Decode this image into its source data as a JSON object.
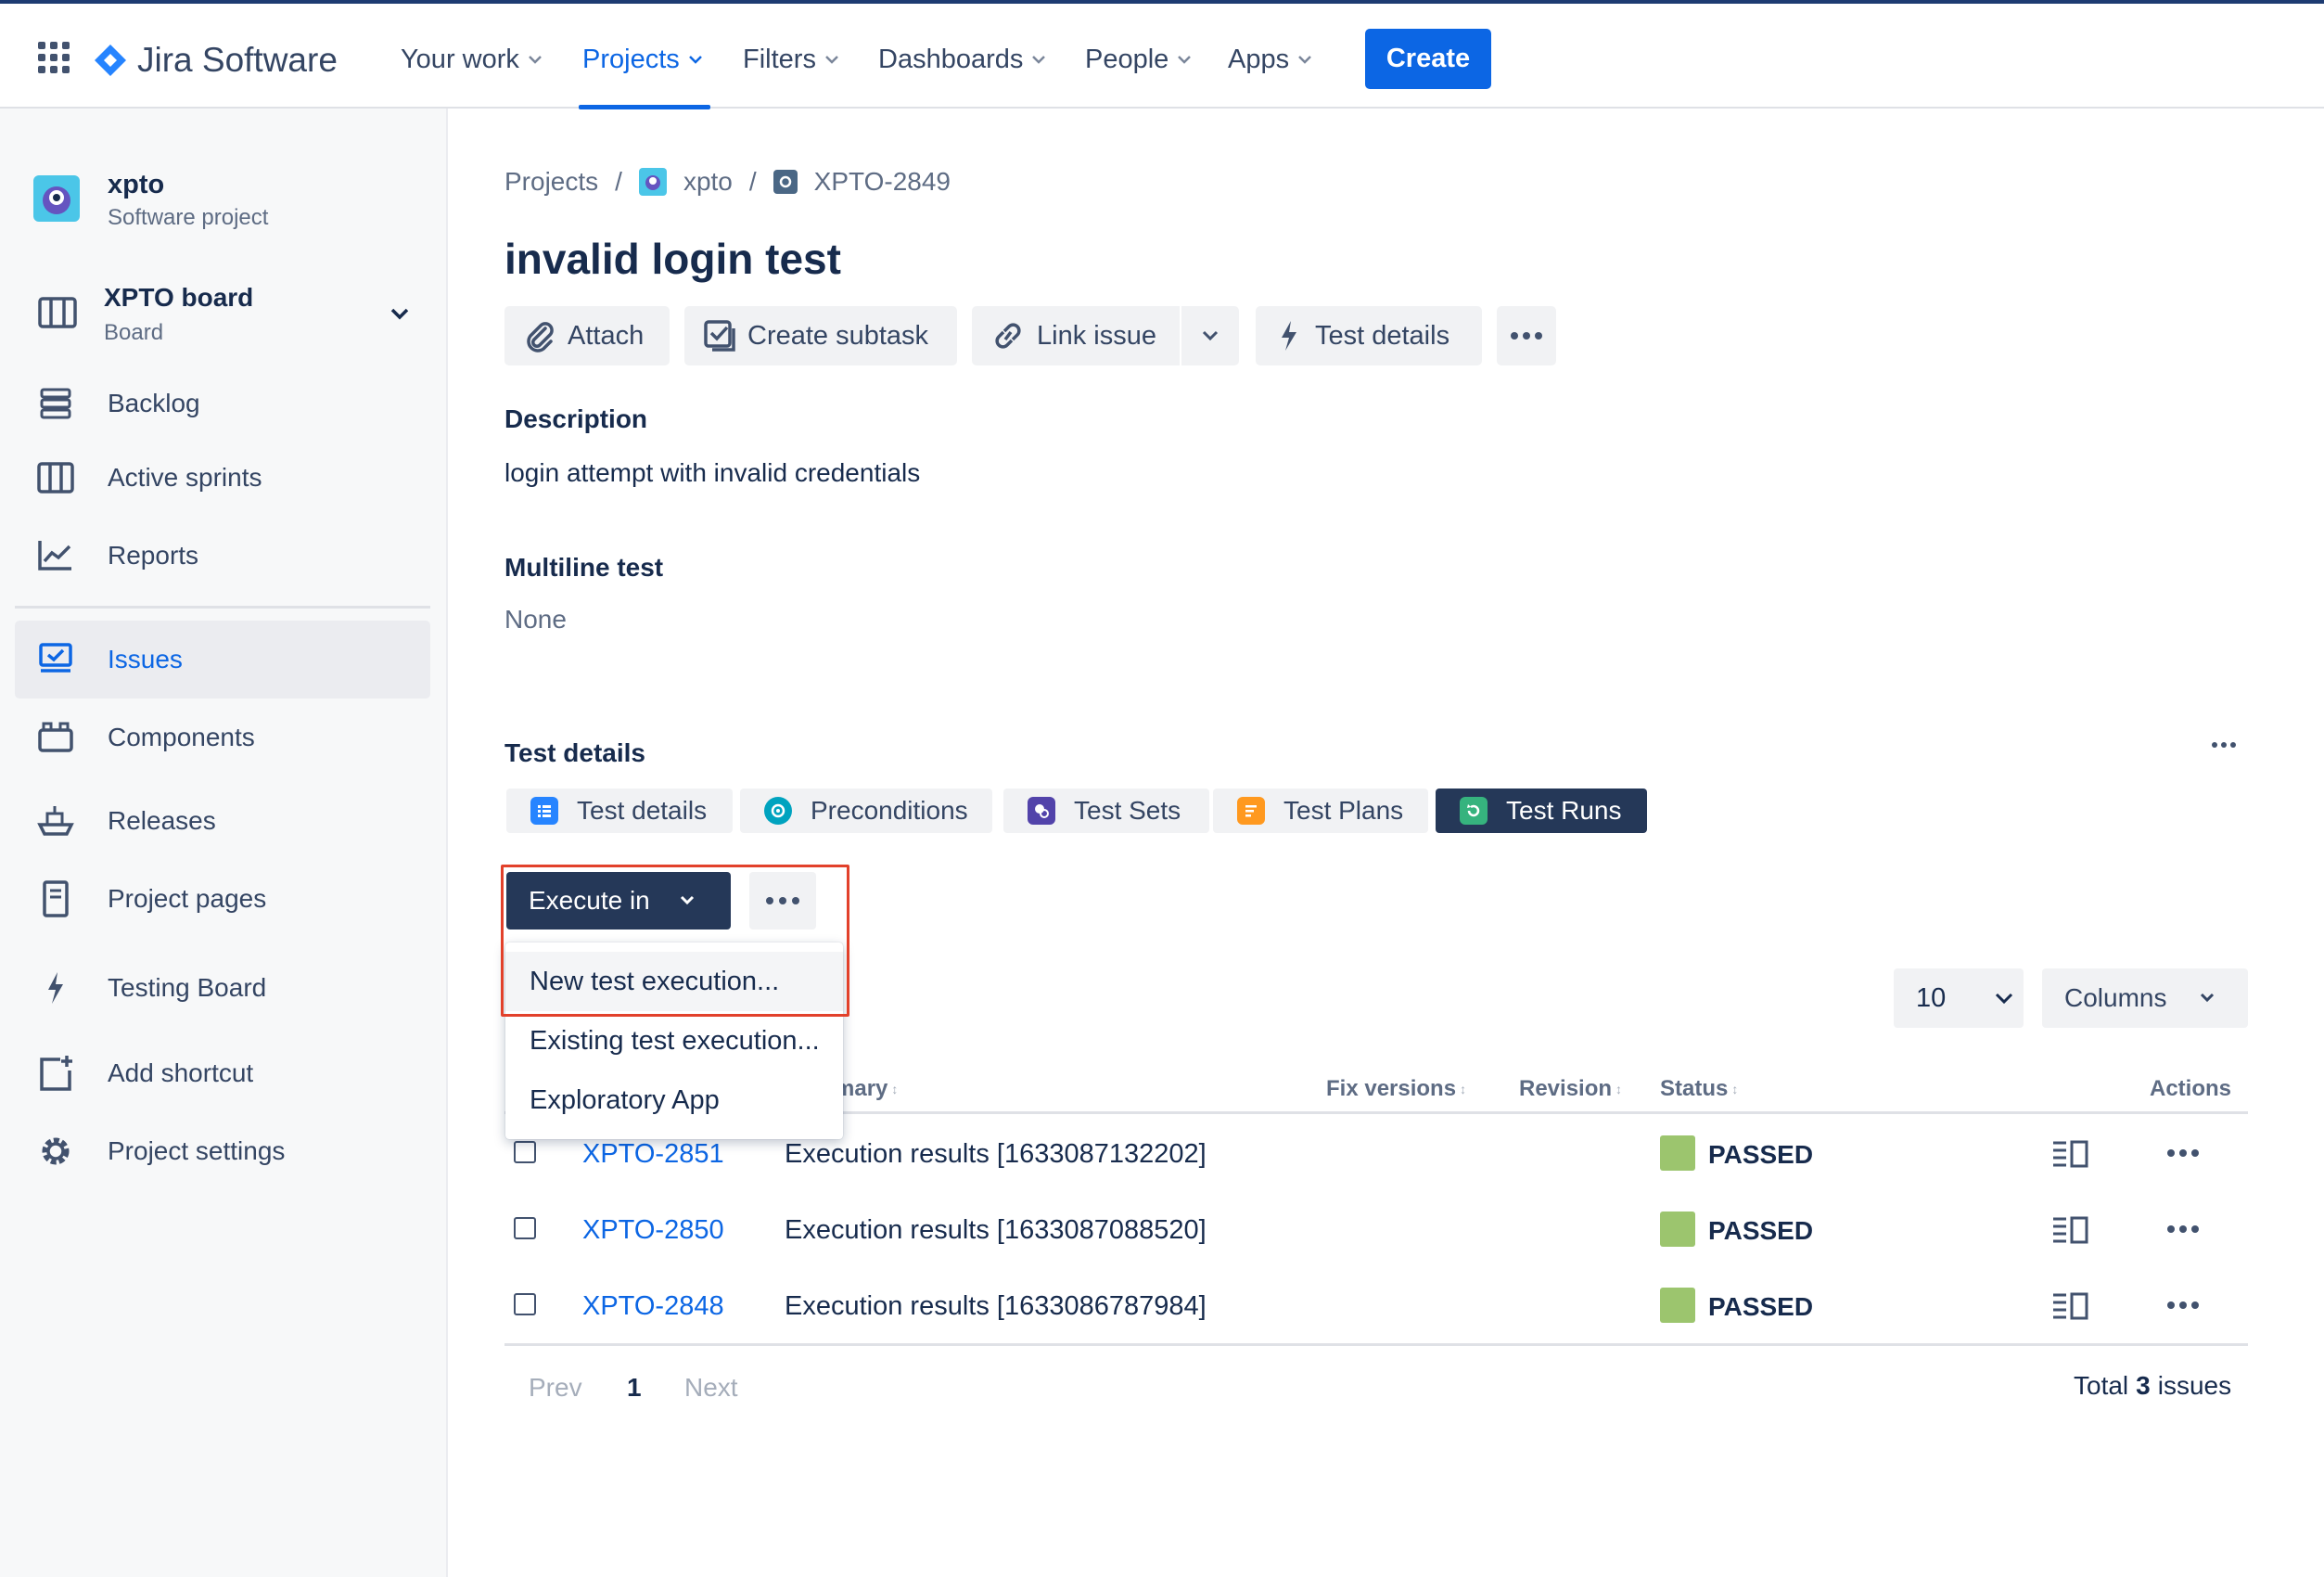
{
  "topnav": {
    "app_name": "Jira Software",
    "items": [
      {
        "label": "Your work"
      },
      {
        "label": "Projects"
      },
      {
        "label": "Filters"
      },
      {
        "label": "Dashboards"
      },
      {
        "label": "People"
      },
      {
        "label": "Apps"
      }
    ],
    "create_label": "Create"
  },
  "sidebar": {
    "project_name": "xpto",
    "project_type": "Software project",
    "board_name": "XPTO board",
    "board_type": "Board",
    "items": [
      {
        "label": "Backlog",
        "icon": "backlog-icon"
      },
      {
        "label": "Active sprints",
        "icon": "sprints-icon"
      },
      {
        "label": "Reports",
        "icon": "reports-icon"
      },
      {
        "label": "Issues",
        "icon": "issues-icon"
      },
      {
        "label": "Components",
        "icon": "components-icon"
      },
      {
        "label": "Releases",
        "icon": "releases-icon"
      },
      {
        "label": "Project pages",
        "icon": "pages-icon"
      },
      {
        "label": "Testing Board",
        "icon": "bolt-icon"
      },
      {
        "label": "Add shortcut",
        "icon": "add-shortcut-icon"
      },
      {
        "label": "Project settings",
        "icon": "gear-icon"
      }
    ]
  },
  "breadcrumb": {
    "projects": "Projects",
    "project": "xpto",
    "issue": "XPTO-2849",
    "sep": "/"
  },
  "issue": {
    "title": "invalid login test",
    "toolbar": {
      "attach": "Attach",
      "create_subtask": "Create subtask",
      "link_issue": "Link issue",
      "test_details": "Test details"
    },
    "description_heading": "Description",
    "description": "login attempt with invalid credentials",
    "multiline_heading": "Multiline test",
    "multiline_value": "None"
  },
  "test_details": {
    "heading": "Test details",
    "tabs": [
      {
        "label": "Test details",
        "color": "#2684ff"
      },
      {
        "label": "Preconditions",
        "color": "#00a3bf"
      },
      {
        "label": "Test Sets",
        "color": "#5243aa"
      },
      {
        "label": "Test Plans",
        "color": "#ff991f"
      },
      {
        "label": "Test Runs",
        "color": "#36b37e"
      }
    ],
    "execute_label": "Execute in",
    "menu": [
      "New test execution...",
      "Existing test execution...",
      "Exploratory App"
    ],
    "page_size": "10",
    "columns_label": "Columns",
    "headers": {
      "summary": "mary",
      "fix_versions": "Fix versions",
      "revision": "Revision",
      "status": "Status",
      "actions": "Actions"
    },
    "rows": [
      {
        "key": "XPTO-2851",
        "summary": "Execution results [1633087132202]",
        "status": "PASSED"
      },
      {
        "key": "XPTO-2850",
        "summary": "Execution results [1633087088520]",
        "status": "PASSED"
      },
      {
        "key": "XPTO-2848",
        "summary": "Execution results [1633086787984]",
        "status": "PASSED"
      }
    ],
    "pagination": {
      "prev": "Prev",
      "page": "1",
      "next": "Next"
    },
    "total": {
      "prefix": "Total",
      "count": "3",
      "suffix": "issues"
    }
  },
  "colors": {
    "brand": "#0c66e4",
    "status_passed": "#9cc56e",
    "dark_tab": "#253858",
    "highlight": "#e2412b"
  }
}
